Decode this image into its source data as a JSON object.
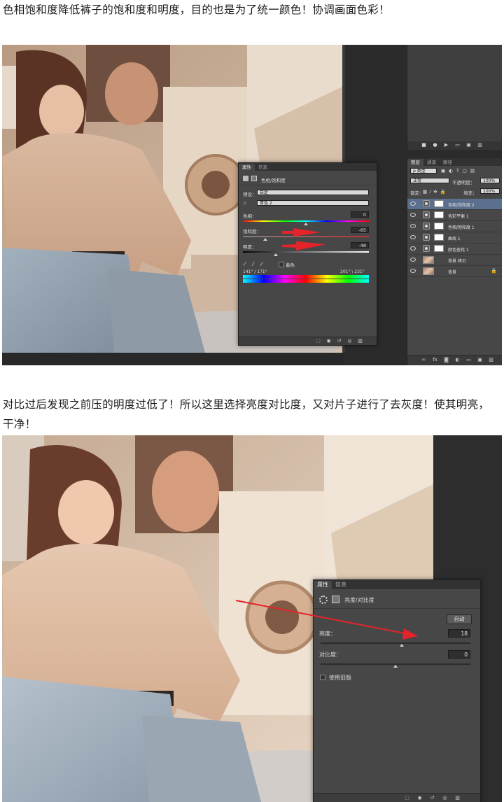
{
  "captions": {
    "first": "色相饱和度降低裤子的饱和度和明度，目的也是为了统一颜色！协调画面色彩！",
    "second": "对比过后发现之前压的明度过低了！所以这里选择亮度对比度，又对片子进行了去灰度！使其明亮，干净！"
  },
  "hue_panel": {
    "tabs": [
      "属性",
      "信息"
    ],
    "title": "色相/饱和度",
    "preset_label": "预设：",
    "preset_value": "自定",
    "channel_value": "青色 2",
    "hue_label": "色相：",
    "hue_value": "0",
    "sat_label": "饱和度：",
    "sat_value": "-65",
    "light_label": "明度：",
    "light_value": "-48",
    "colorize_label": "着色",
    "range_left": "141° / 171°",
    "range_right": "201° \\ 231°",
    "hue_slider": 0.5,
    "sat_slider": 0.18,
    "light_slider": 0.26
  },
  "layers_panel": {
    "tabs": [
      "图层",
      "通道",
      "路径"
    ],
    "kind_label": "ρ 类型",
    "blend_mode": "正常",
    "opacity_label": "不透明度：",
    "opacity_value": "100%",
    "lock_label": "锁定：",
    "fill_label": "填充：",
    "fill_value": "100%",
    "layers": [
      {
        "name": "色相/饱和度 2",
        "type": "adjust",
        "selected": true
      },
      {
        "name": "色彩平衡 1",
        "type": "adjust",
        "selected": false
      },
      {
        "name": "色相/饱和度 1",
        "type": "adjust",
        "selected": false
      },
      {
        "name": "曲线 1",
        "type": "adjust",
        "selected": false
      },
      {
        "name": "颜色查找 1",
        "type": "adjust",
        "selected": false
      },
      {
        "name": "背景 拷贝",
        "type": "image",
        "selected": false
      },
      {
        "name": "背景",
        "type": "image",
        "selected": false
      }
    ]
  },
  "bc_panel": {
    "tabs": [
      "属性",
      "信息"
    ],
    "title": "亮度/对比度",
    "auto_label": "自动",
    "brightness_label": "亮度：",
    "brightness_value": "18",
    "contrast_label": "对比度：",
    "contrast_value": "0",
    "legacy_label": "使用旧版",
    "brightness_slider": 0.54,
    "contrast_slider": 0.5
  },
  "colors": {
    "arrow_red": "#e5232a",
    "ps_panel": "#474747",
    "ps_dark": "#2b2b2b"
  }
}
